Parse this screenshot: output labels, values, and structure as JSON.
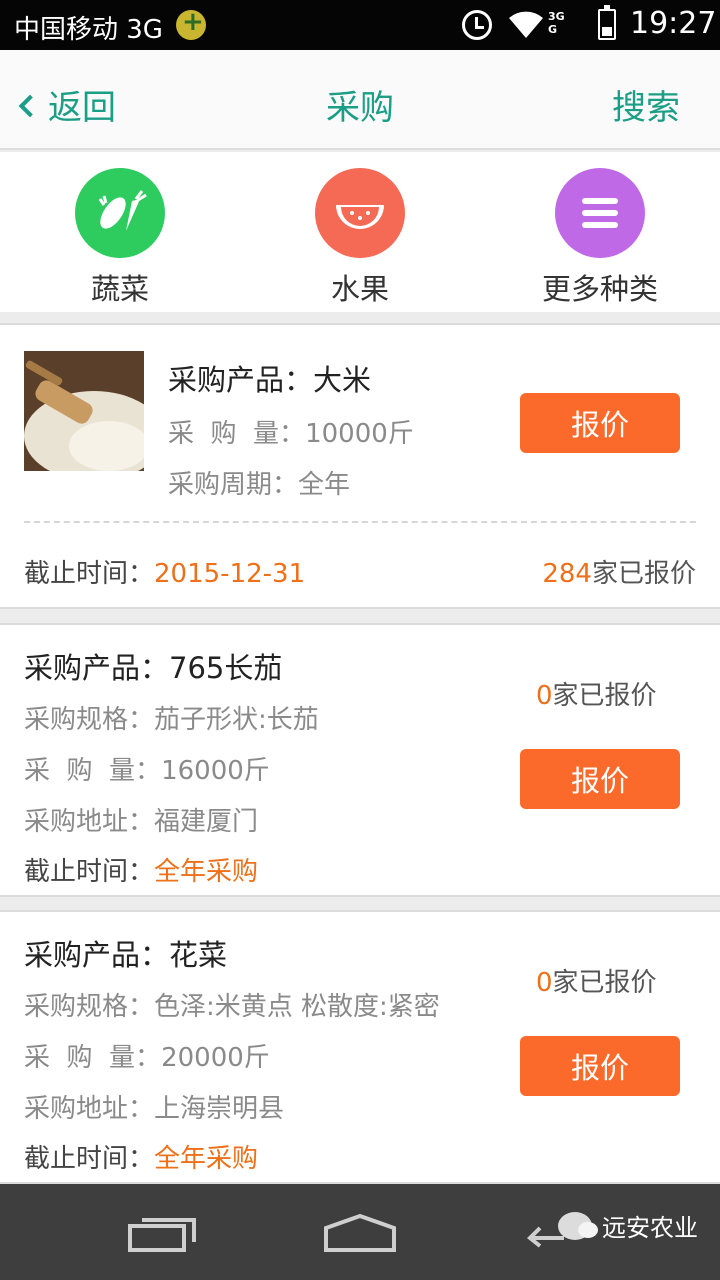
{
  "status_bar": {
    "carrier": "中国移动 3G",
    "net_top": "3G",
    "net_bottom": "G",
    "time": "19:27"
  },
  "header": {
    "back_label": "返回",
    "title": "采购",
    "search_label": "搜索"
  },
  "categories": [
    {
      "label": "蔬菜",
      "color": "#2ecc5f",
      "icon": "vegetable-icon"
    },
    {
      "label": "水果",
      "color": "#f46a55",
      "icon": "watermelon-icon"
    },
    {
      "label": "更多种类",
      "color": "#c069e6",
      "icon": "menu-icon"
    }
  ],
  "listings": [
    {
      "product_label": "采购产品：",
      "product": "大米",
      "qty_label": "采  购  量：",
      "qty": "10000斤",
      "period_label": "采购周期：",
      "period": "全年",
      "deadline_label": "截止时间：",
      "deadline": "2015-12-31",
      "quote_count": "284",
      "quote_suffix": "家已报价",
      "button": "报价"
    },
    {
      "product_label": "采购产品：",
      "product": "765长茄",
      "spec_label": "采购规格：",
      "spec": "茄子形状:长茄",
      "qty_label": "采  购  量：",
      "qty": "16000斤",
      "addr_label": "采购地址：",
      "addr": "福建厦门",
      "deadline_label": "截止时间：",
      "deadline": "全年采购",
      "quote_count": "0",
      "quote_suffix": "家已报价",
      "button": "报价"
    },
    {
      "product_label": "采购产品：",
      "product": "花菜",
      "spec_label": "采购规格：",
      "spec": "色泽:米黄点 松散度:紧密",
      "qty_label": "采  购  量：",
      "qty": "20000斤",
      "addr_label": "采购地址：",
      "addr": "上海崇明县",
      "deadline_label": "截止时间：",
      "deadline": "全年采购",
      "quote_count": "0",
      "quote_suffix": "家已报价",
      "button": "报价"
    }
  ],
  "watermark": "远安农业"
}
